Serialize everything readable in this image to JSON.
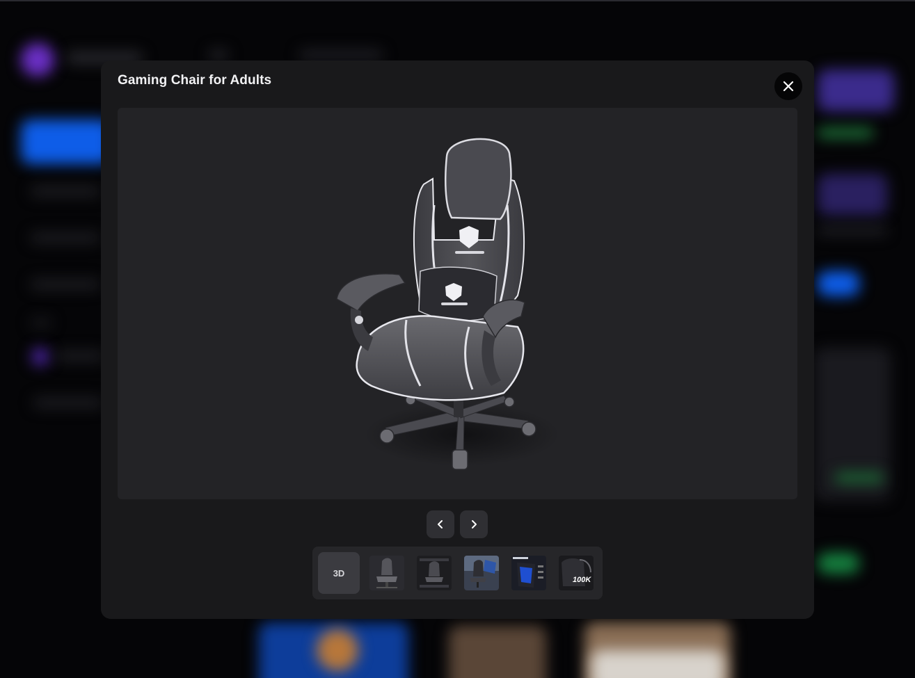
{
  "modal": {
    "title": "Gaming Chair for Adults"
  },
  "icons": {
    "close": "close-icon",
    "prev": "chevron-left-icon",
    "next": "chevron-right-icon"
  },
  "thumbnails": {
    "first_label": "3D",
    "items": [
      {
        "name": "chair-photo-1"
      },
      {
        "name": "chair-photo-2"
      },
      {
        "name": "chair-photo-3"
      },
      {
        "name": "chair-photo-4"
      },
      {
        "name": "chair-photo-5",
        "badge": "100K"
      }
    ]
  },
  "colors": {
    "modal_bg": "#19191b",
    "viewer_bg": "#232326",
    "accent_blue": "#1b6bff",
    "accent_purple": "#7b3fe4",
    "accent_green": "#22c55e"
  }
}
